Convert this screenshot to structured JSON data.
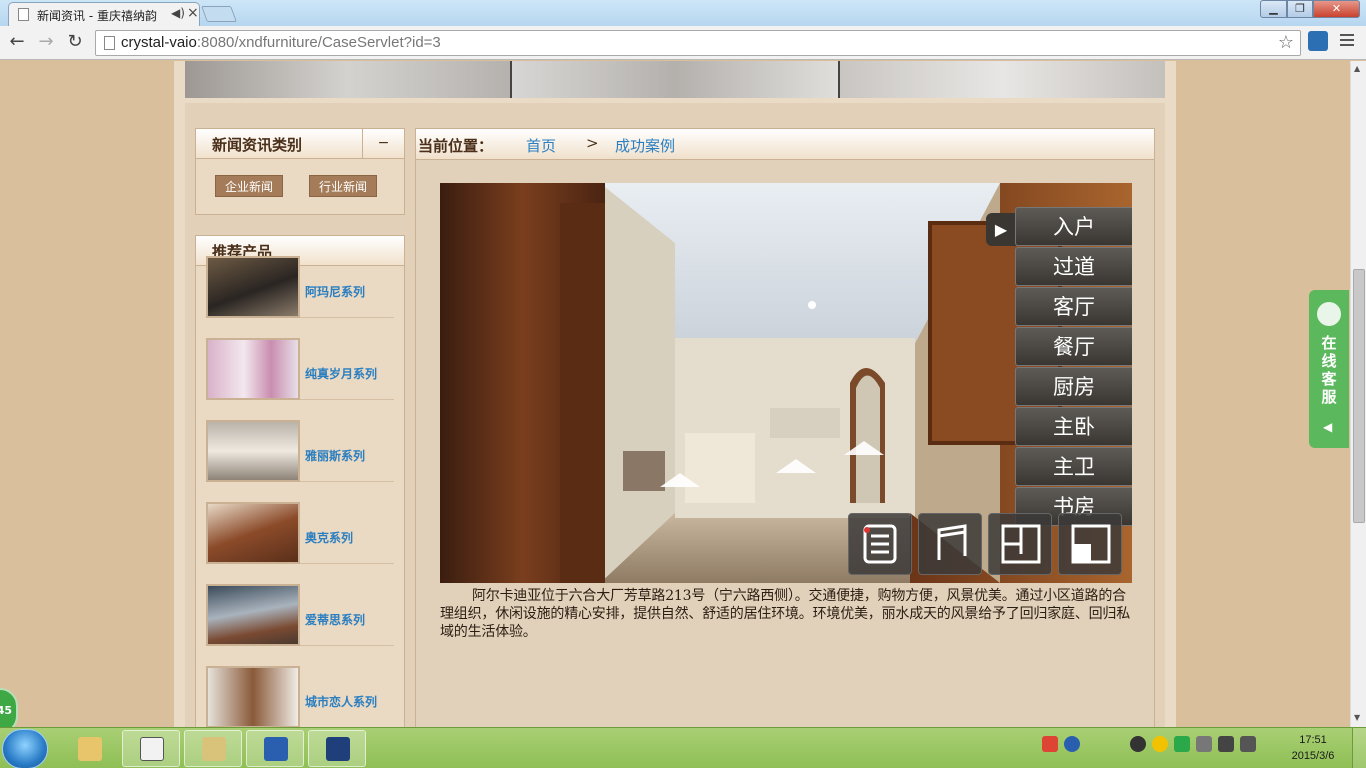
{
  "browser": {
    "tab_title": "新闻资讯 - 重庆禧纳韵",
    "url_host": "crystal-vaio",
    "url_rest": ":8080/xndfurniture/CaseServlet?id=3"
  },
  "sidebar": {
    "news_categories": {
      "title": "新闻资讯类别",
      "collapse_label": "−",
      "items": [
        "企业新闻",
        "行业新闻"
      ]
    },
    "recommended": {
      "title": "推荐产品",
      "items": [
        {
          "name": "阿玛尼系列"
        },
        {
          "name": "纯真岁月系列"
        },
        {
          "name": "雅丽斯系列"
        },
        {
          "name": "奥克系列"
        },
        {
          "name": "爱蒂思系列"
        },
        {
          "name": "城市恋人系列"
        }
      ]
    }
  },
  "breadcrumb": {
    "label": "当前位置：",
    "home": "首页",
    "separator": ">",
    "current": "成功案例"
  },
  "viewer": {
    "rooms": [
      "入户",
      "过道",
      "客厅",
      "餐厅",
      "厨房",
      "主卧",
      "主卫",
      "书房"
    ],
    "toggle_icon": "play-icon",
    "buttons": [
      "list-icon",
      "music-icon",
      "floorplan-icon",
      "fullscreen-icon"
    ]
  },
  "description": "阿尔卡迪亚位于六合大厂芳草路213号（宁六路西侧）。交通便捷，购物方便，风景优美。通过小区道路的合理组织，休闲设施的精心安排，提供自然、舒适的居住环境。环境优美，丽水成天的风景给予了回归家庭、回归私域的生活体验。",
  "online_service": {
    "label": "在线客服"
  },
  "speed_badge": "45",
  "taskbar": {
    "time": "17:51",
    "date": "2015/3/6"
  }
}
